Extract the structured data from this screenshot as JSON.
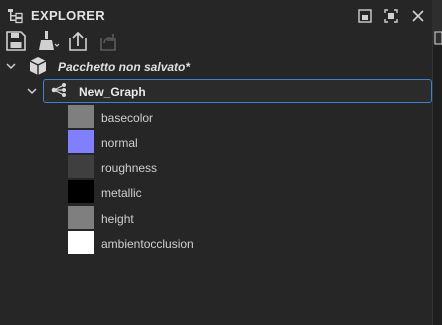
{
  "panel": {
    "title": "EXPLORER"
  },
  "package": {
    "name": "Pacchetto non salvato*"
  },
  "graph": {
    "name": "New_Graph"
  },
  "outputs": [
    {
      "label": "basecolor",
      "color": "#7f7f7f"
    },
    {
      "label": "normal",
      "color": "#7f7fff"
    },
    {
      "label": "roughness",
      "color": "#3f3f3f"
    },
    {
      "label": "metallic",
      "color": "#000000"
    },
    {
      "label": "height",
      "color": "#7f7f7f"
    },
    {
      "label": "ambientocclusion",
      "color": "#ffffff"
    }
  ],
  "icons": {
    "panel": "tree-icon",
    "toolbar": [
      "save-icon",
      "clean-icon",
      "publish-icon",
      "reload-icon"
    ],
    "window": [
      "float-icon",
      "maximize-icon",
      "close-icon"
    ]
  },
  "colors": {
    "background": "#262626",
    "selection_border": "#3e82cc"
  }
}
